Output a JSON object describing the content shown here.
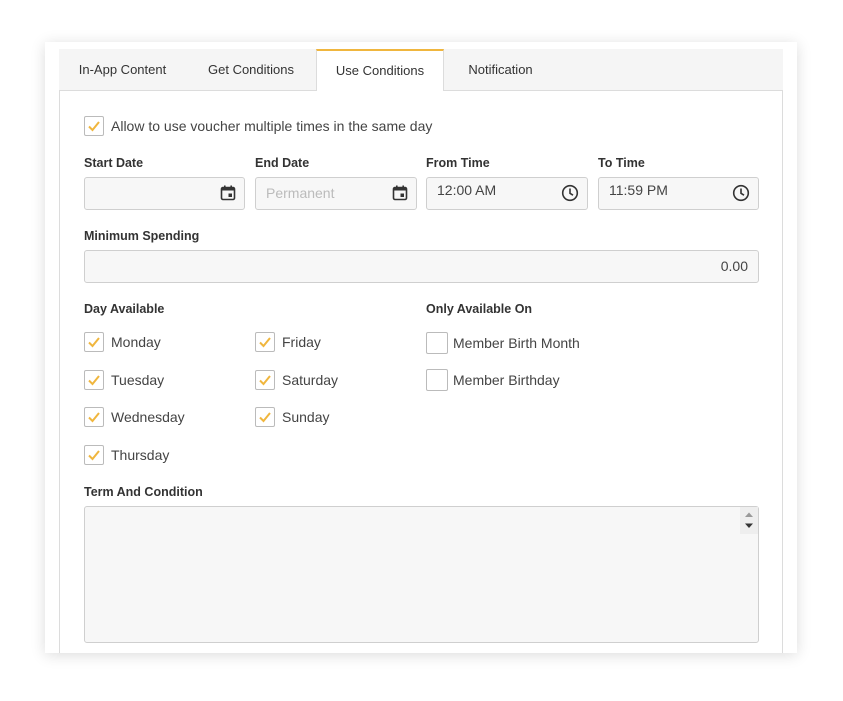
{
  "tabs": [
    {
      "label": "In-App Content"
    },
    {
      "label": "Get Conditions"
    },
    {
      "label": "Use Conditions"
    },
    {
      "label": "Notification"
    }
  ],
  "multiple_use": {
    "label": "Allow to use voucher multiple times in the same day",
    "checked": true
  },
  "fields": {
    "start_date": {
      "label": "Start Date",
      "value": ""
    },
    "end_date": {
      "label": "End Date",
      "placeholder": "Permanent"
    },
    "from_time": {
      "label": "From Time",
      "value": "12:00 AM"
    },
    "to_time": {
      "label": "To Time",
      "value": "11:59 PM"
    },
    "min_spending": {
      "label": "Minimum Spending",
      "value": "0.00"
    }
  },
  "day_available": {
    "label": "Day Available",
    "days": [
      {
        "label": "Monday",
        "checked": true
      },
      {
        "label": "Tuesday",
        "checked": true
      },
      {
        "label": "Wednesday",
        "checked": true
      },
      {
        "label": "Thursday",
        "checked": true
      },
      {
        "label": "Friday",
        "checked": true
      },
      {
        "label": "Saturday",
        "checked": true
      },
      {
        "label": "Sunday",
        "checked": true
      }
    ]
  },
  "only_available": {
    "label": "Only Available On",
    "options": [
      {
        "label": "Member Birth Month",
        "checked": false
      },
      {
        "label": "Member Birthday",
        "checked": false
      }
    ]
  },
  "term": {
    "label": "Term And Condition",
    "value": ""
  },
  "colors": {
    "accent": "#f0b63e",
    "border": "#dcdcdc",
    "field_bg": "#f7f7f7"
  },
  "icons": {
    "date": "calendar-icon",
    "time": "clock-icon",
    "check": "checkmark-icon"
  }
}
